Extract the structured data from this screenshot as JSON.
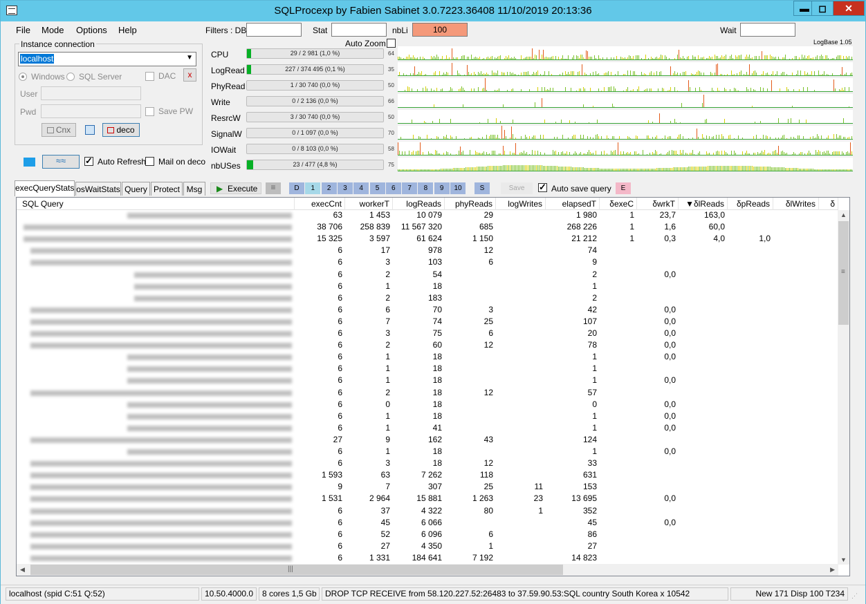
{
  "window": {
    "title": "SQLProcexp by Fabien Sabinet 3.0.7223.36408 11/10/2019 20:13:36",
    "minimize": "▬",
    "maximize": "◻",
    "close": "✕"
  },
  "menu": [
    "File",
    "Mode",
    "Options",
    "Help"
  ],
  "filters": {
    "db_label": "Filters : DB",
    "db_value": "",
    "stat_label": "Stat",
    "stat_value": "",
    "nbli_label": "nbLi",
    "nbli_value": "100",
    "wait_label": "Wait",
    "wait_value": "",
    "auto_zoom": "Auto Zoom",
    "logbase": "LogBase 1.05"
  },
  "instance": {
    "caption": "Instance connection",
    "server": "localhost",
    "windows": "Windows",
    "sqlserver": "SQL Server",
    "dac": "DAC",
    "clear": "x",
    "user_label": "User",
    "pwd_label": "Pwd",
    "save_pw": "Save PW",
    "cnx": "Cnx",
    "deco": "deco",
    "auto_refresh": "Auto Refresh",
    "mail_on_deco": "Mail on deco"
  },
  "metrics": [
    {
      "name": "CPU",
      "bar": "29 / 2 981 (1,0 %)",
      "fill": 1.0,
      "max": "64"
    },
    {
      "name": "LogRead",
      "bar": "227 / 374 495 (0,1 %)",
      "fill": 0.1,
      "max": "35"
    },
    {
      "name": "PhyRead",
      "bar": "1 / 30 740 (0,0 %)",
      "fill": 0,
      "max": "50"
    },
    {
      "name": "Write",
      "bar": "0 / 2 136 (0,0 %)",
      "fill": 0,
      "max": "66"
    },
    {
      "name": "ResrcW",
      "bar": "3 / 30 740 (0,0 %)",
      "fill": 0,
      "max": "50"
    },
    {
      "name": "SignalW",
      "bar": "0 / 1 097 (0,0 %)",
      "fill": 0,
      "max": "70"
    },
    {
      "name": "IOWait",
      "bar": "0 / 8 103 (0,0 %)",
      "fill": 0,
      "max": "58"
    },
    {
      "name": "nbUSes",
      "bar": "23 / 477 (4,8 %)",
      "fill": 4.8,
      "max": "75"
    }
  ],
  "tabs": [
    "execQueryStats",
    "osWaitStats",
    "Query",
    "Protect",
    "Msg"
  ],
  "toolbar": {
    "execute": "Execute",
    "numtabs": [
      "D",
      "1",
      "2",
      "3",
      "4",
      "5",
      "6",
      "7",
      "8",
      "9",
      "10"
    ],
    "s": "S",
    "save": "Save",
    "auto_save": "Auto save query",
    "e": "E"
  },
  "columns": [
    "SQL Query",
    "execCnt",
    "workerT",
    "logReads",
    "phyReads",
    "logWrites",
    "elapsedT",
    "δexeC",
    "δwrkT",
    "▼δlReads",
    "δpReads",
    "δlWrites",
    "δ"
  ],
  "rows": [
    [
      "63",
      "1 453",
      "10 079",
      "29",
      "",
      "1 980",
      "1",
      "23,7",
      "163,0",
      ""
    ],
    [
      "38 706",
      "258 839",
      "11 567 320",
      "685",
      "",
      "268 226",
      "1",
      "1,6",
      "60,0",
      ""
    ],
    [
      "15 325",
      "3 597",
      "61 624",
      "1 150",
      "",
      "21 212",
      "1",
      "0,3",
      "4,0",
      "1,0"
    ],
    [
      "6",
      "17",
      "978",
      "12",
      "",
      "74",
      "",
      "",
      "",
      ""
    ],
    [
      "6",
      "3",
      "103",
      "6",
      "",
      "9",
      "",
      "",
      "",
      ""
    ],
    [
      "6",
      "2",
      "54",
      "",
      "",
      "2",
      "",
      "0,0",
      "",
      ""
    ],
    [
      "6",
      "1",
      "18",
      "",
      "",
      "1",
      "",
      "",
      "",
      ""
    ],
    [
      "6",
      "2",
      "183",
      "",
      "",
      "2",
      "",
      "",
      "",
      ""
    ],
    [
      "6",
      "6",
      "70",
      "3",
      "",
      "42",
      "",
      "0,0",
      "",
      ""
    ],
    [
      "6",
      "7",
      "74",
      "25",
      "",
      "107",
      "",
      "0,0",
      "",
      ""
    ],
    [
      "6",
      "3",
      "75",
      "6",
      "",
      "20",
      "",
      "0,0",
      "",
      ""
    ],
    [
      "6",
      "2",
      "60",
      "12",
      "",
      "78",
      "",
      "0,0",
      "",
      ""
    ],
    [
      "6",
      "1",
      "18",
      "",
      "",
      "1",
      "",
      "0,0",
      "",
      ""
    ],
    [
      "6",
      "1",
      "18",
      "",
      "",
      "1",
      "",
      "",
      "",
      ""
    ],
    [
      "6",
      "1",
      "18",
      "",
      "",
      "1",
      "",
      "0,0",
      "",
      ""
    ],
    [
      "6",
      "2",
      "18",
      "12",
      "",
      "57",
      "",
      "",
      "",
      ""
    ],
    [
      "6",
      "0",
      "18",
      "",
      "",
      "0",
      "",
      "0,0",
      "",
      ""
    ],
    [
      "6",
      "1",
      "18",
      "",
      "",
      "1",
      "",
      "0,0",
      "",
      ""
    ],
    [
      "6",
      "1",
      "41",
      "",
      "",
      "1",
      "",
      "0,0",
      "",
      ""
    ],
    [
      "27",
      "9",
      "162",
      "43",
      "",
      "124",
      "",
      "",
      "",
      ""
    ],
    [
      "6",
      "1",
      "18",
      "",
      "",
      "1",
      "",
      "0,0",
      "",
      ""
    ],
    [
      "6",
      "3",
      "18",
      "12",
      "",
      "33",
      "",
      "",
      "",
      ""
    ],
    [
      "1 593",
      "63",
      "7 262",
      "118",
      "",
      "631",
      "",
      "",
      "",
      ""
    ],
    [
      "9",
      "7",
      "307",
      "25",
      "11",
      "153",
      "",
      "",
      "",
      ""
    ],
    [
      "1 531",
      "2 964",
      "15 881",
      "1 263",
      "23",
      "13 695",
      "",
      "0,0",
      "",
      ""
    ],
    [
      "6",
      "37",
      "4 322",
      "80",
      "1",
      "352",
      "",
      "",
      "",
      ""
    ],
    [
      "6",
      "45",
      "6 066",
      "",
      "",
      "45",
      "",
      "0,0",
      "",
      ""
    ],
    [
      "6",
      "52",
      "6 096",
      "6",
      "",
      "86",
      "",
      "",
      "",
      ""
    ],
    [
      "6",
      "27",
      "4 350",
      "1",
      "",
      "27",
      "",
      "",
      "",
      ""
    ],
    [
      "6",
      "1 331",
      "184 641",
      "7 192",
      "",
      "14 823",
      "",
      "",
      "",
      ""
    ]
  ],
  "status": {
    "conn": "localhost (spid C:51 Q:52)",
    "version": "10.50.4000.0",
    "cores": "8 cores 1,5 Gb",
    "event": "DROP TCP RECEIVE from 58.120.227.52:26483 to 37.59.90.53:SQL country South Korea x 10542",
    "counts": "New 171 Disp 100 T234"
  }
}
